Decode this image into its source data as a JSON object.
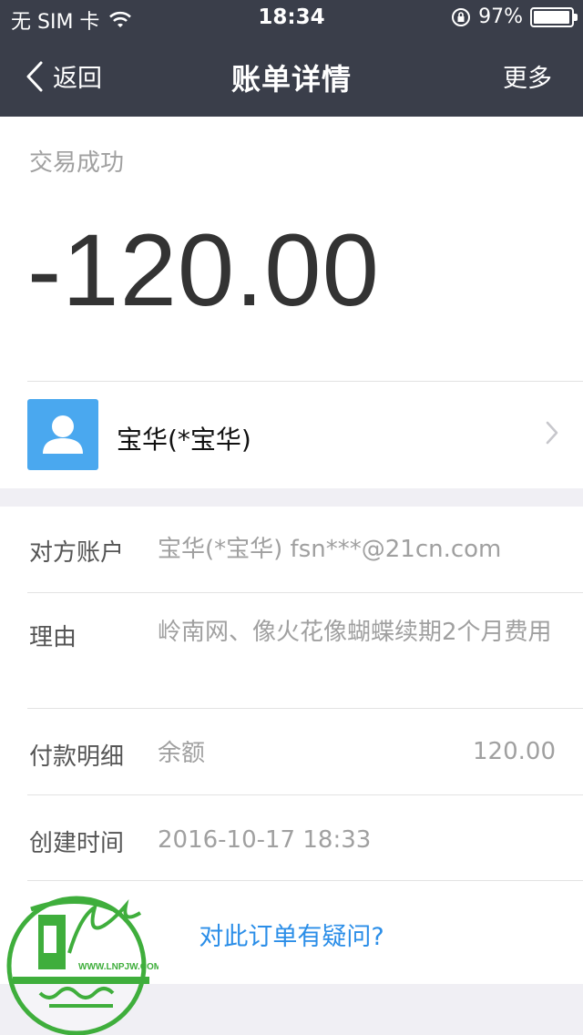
{
  "status_bar": {
    "carrier": "无 SIM 卡",
    "time": "18:34",
    "battery_percent_text": "97%",
    "battery_level": 0.97
  },
  "nav": {
    "back_label": "返回",
    "title": "账单详情",
    "more_label": "更多"
  },
  "transaction": {
    "status": "交易成功",
    "amount": "-120.00",
    "payee_name": "宝华(*宝华)"
  },
  "details": {
    "account_label": "对方账户",
    "account_value": "宝华(*宝华) fsn***@21cn.com",
    "reason_label": "理由",
    "reason_value": "岭南网、像火花像蝴蝶续期2个月费用",
    "payment_label": "付款明细",
    "payment_method": "余额",
    "payment_amount": "120.00",
    "created_label": "创建时间",
    "created_value": "2016-10-17 18:33"
  },
  "question_link": "对此订单有疑问?",
  "watermark": {
    "url_text": "WWW.LNPJW.COM",
    "primary_color": "#3fae3c"
  },
  "colors": {
    "nav_bg": "#3a3e4a",
    "avatar_bg": "#4aa8ef",
    "link": "#2b8ee8"
  }
}
